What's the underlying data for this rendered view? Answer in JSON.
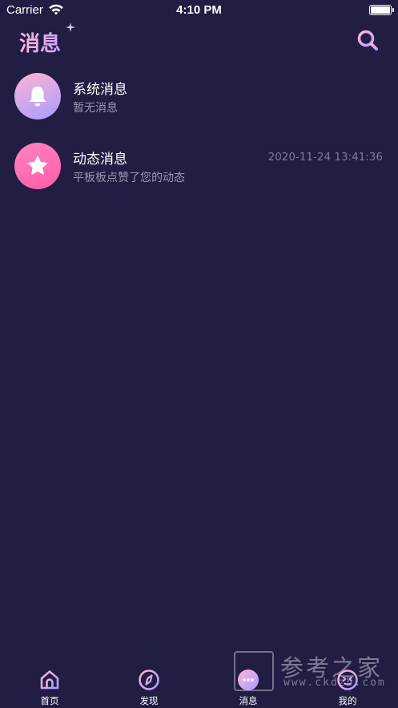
{
  "status_bar": {
    "carrier": "Carrier",
    "time": "4:10 PM"
  },
  "header": {
    "title": "消息"
  },
  "messages": [
    {
      "title": "系统消息",
      "subtitle": "暂无消息",
      "time": "",
      "icon": "bell-icon"
    },
    {
      "title": "动态消息",
      "subtitle": "平板板点赞了您的动态",
      "time": "2020-11-24 13:41:36",
      "icon": "star-icon"
    }
  ],
  "tabs": [
    {
      "label": "首页",
      "icon": "home-icon"
    },
    {
      "label": "发现",
      "icon": "compass-icon"
    },
    {
      "label": "消息",
      "icon": "message-icon",
      "active": true
    },
    {
      "label": "我的",
      "icon": "profile-icon"
    }
  ],
  "watermark": {
    "text": "参考之家",
    "url": "www.ckdzb.com"
  },
  "colors": {
    "background": "#221d43",
    "accent_pink": "#ff6fb5",
    "accent_purple": "#a89cff",
    "muted_text": "#9a97b2"
  }
}
